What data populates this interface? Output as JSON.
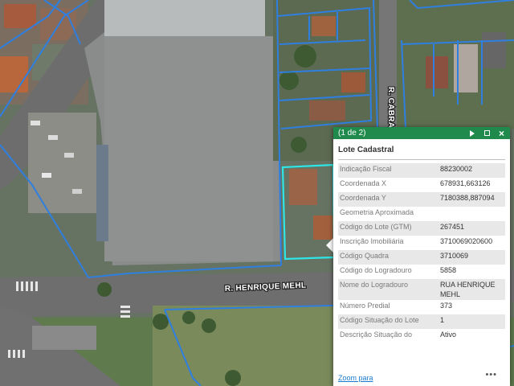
{
  "map": {
    "road_labels": [
      "R. CABRAL",
      "R. HENRIQUE MEHL"
    ]
  },
  "popup": {
    "counter": "(1 de 2)",
    "title": "Lote Cadastral",
    "attributes": [
      {
        "key": "Indicação Fiscal",
        "value": "88230002"
      },
      {
        "key": "Coordenada X",
        "value": "678931,663126"
      },
      {
        "key": "Coordenada Y",
        "value": "7180388,887094"
      },
      {
        "key": "Geometria Aproximada",
        "value": ""
      },
      {
        "key": "Código do Lote (GTM)",
        "value": "267451"
      },
      {
        "key": "Inscrição Imobiliária",
        "value": "3710069020600"
      },
      {
        "key": "Código Quadra",
        "value": "3710069"
      },
      {
        "key": "Código do Logradouro",
        "value": "5858"
      },
      {
        "key": "Nome do Logradouro",
        "value": "RUA HENRIQUE MEHL"
      },
      {
        "key": "Número Predial",
        "value": "373"
      },
      {
        "key": "Código Situação do Lote",
        "value": "1"
      },
      {
        "key": "Descrição Situação do",
        "value": "Ativo"
      }
    ],
    "zoom_link": "Zoom para",
    "more": "•••"
  },
  "colors": {
    "header": "#1f8a4c",
    "parcel_outline": "#2f7fe0",
    "selected_outline": "#2ee6e6"
  },
  "icons": [
    "play-icon",
    "maximize-icon",
    "close-icon",
    "more-icon"
  ]
}
